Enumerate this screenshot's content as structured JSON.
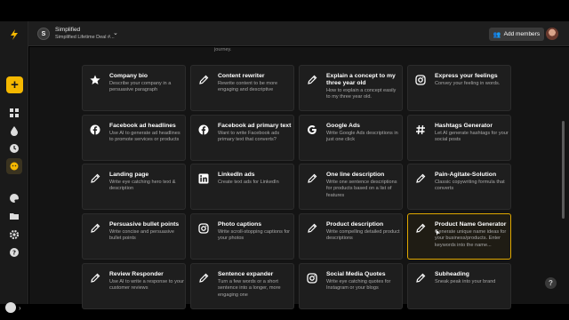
{
  "topbar": {
    "workspace_initial": "S",
    "workspace_name": "Simplified",
    "workspace_plan": "Simplified Lifetime Deal #...",
    "add_members_label": "Add members"
  },
  "rail": {
    "add_label": "+"
  },
  "partial_text": "journey.",
  "cards": [
    {
      "title": "Company bio",
      "desc": "Describe your company in a persuasive paragraph",
      "icon": "star-icon"
    },
    {
      "title": "Content rewriter",
      "desc": "Rewrite content to be more engaging and descriptive",
      "icon": "pencil-icon"
    },
    {
      "title": "Explain a concept to my three year old",
      "desc": "How to explain a concept easily to my three year old.",
      "icon": "pencil-icon"
    },
    {
      "title": "Express your feelings",
      "desc": "Convey your feeling in words.",
      "icon": "instagram-icon"
    },
    {
      "title": "Facebook ad headlines",
      "desc": "Use AI to generate ad headlines to promote services or products",
      "icon": "facebook-icon"
    },
    {
      "title": "Facebook ad primary text",
      "desc": "Want to write Facebook ads primary text that converts?",
      "icon": "facebook-icon"
    },
    {
      "title": "Google Ads",
      "desc": "Write Google Ads descriptions in just one click",
      "icon": "google-icon"
    },
    {
      "title": "Hashtags Generator",
      "desc": "Let AI generate hashtags for your social posts",
      "icon": "hashtag-icon"
    },
    {
      "title": "Landing page",
      "desc": "Write eye catching hero text & description",
      "icon": "pencil-icon"
    },
    {
      "title": "LinkedIn ads",
      "desc": "Create text ads for LinkedIn",
      "icon": "linkedin-icon"
    },
    {
      "title": "One line description",
      "desc": "Write one sentence descriptions for products based on a list of features",
      "icon": "pencil-icon"
    },
    {
      "title": "Pain-Agitate-Solution",
      "desc": "Classic copywriting formula that converts",
      "icon": "pencil-icon"
    },
    {
      "title": "Persuasive bullet points",
      "desc": "Write concise and persuasive bullet points",
      "icon": "pencil-icon"
    },
    {
      "title": "Photo captions",
      "desc": "Write scroll-stopping captions for your photos",
      "icon": "instagram-icon"
    },
    {
      "title": "Product description",
      "desc": "Write compelling detailed product descriptions",
      "icon": "pencil-icon"
    },
    {
      "title": "Product Name Generator",
      "desc": "Generate unique name ideas for your business/products. Enter keywords into the name...",
      "icon": "pencil-icon"
    },
    {
      "title": "Review Responder",
      "desc": "Use AI to write a response to your customer reviews",
      "icon": "pencil-icon"
    },
    {
      "title": "Sentence expander",
      "desc": "Turn a few words or a short sentence into a longer, more engaging one",
      "icon": "pencil-icon"
    },
    {
      "title": "Social Media Quotes",
      "desc": "Write eye catching quotes for Instagram or your blogs",
      "icon": "instagram-icon"
    },
    {
      "title": "Subheading",
      "desc": "Sneak peak into your brand",
      "icon": "pencil-icon"
    }
  ],
  "help_label": "?",
  "colors": {
    "accent": "#f5b800",
    "selected_border": "#e0a800",
    "card_bg": "#1e1e1e"
  }
}
